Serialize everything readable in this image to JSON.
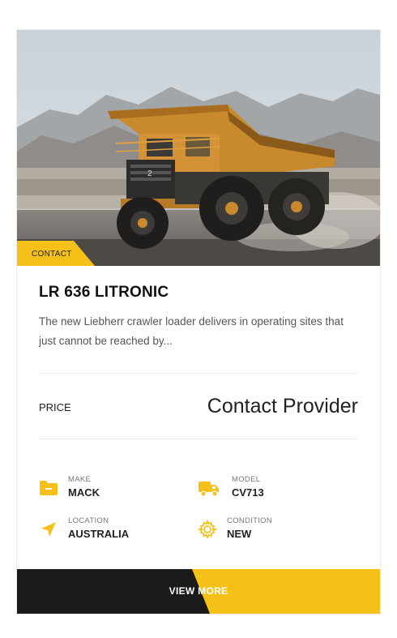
{
  "listing": {
    "tag": "CONTACT",
    "title": "LR 636 LITRONIC",
    "description": "The new Liebherr crawler loader delivers in operating sites that just cannot be reached by...",
    "price_label": "PRICE",
    "price_value": "Contact Provider",
    "truck_number": "2"
  },
  "specs": [
    {
      "label": "MAKE",
      "value": "MACK",
      "icon": "folder-icon"
    },
    {
      "label": "MODEL",
      "value": "CV713",
      "icon": "truck-icon"
    },
    {
      "label": "LOCATION",
      "value": "AUSTRALIA",
      "icon": "location-arrow-icon"
    },
    {
      "label": "CONDITION",
      "value": "NEW",
      "icon": "gear-icon"
    }
  ],
  "button": {
    "label": "VIEW MORE"
  },
  "colors": {
    "accent": "#f5c118",
    "dark": "#1a1a1a"
  }
}
